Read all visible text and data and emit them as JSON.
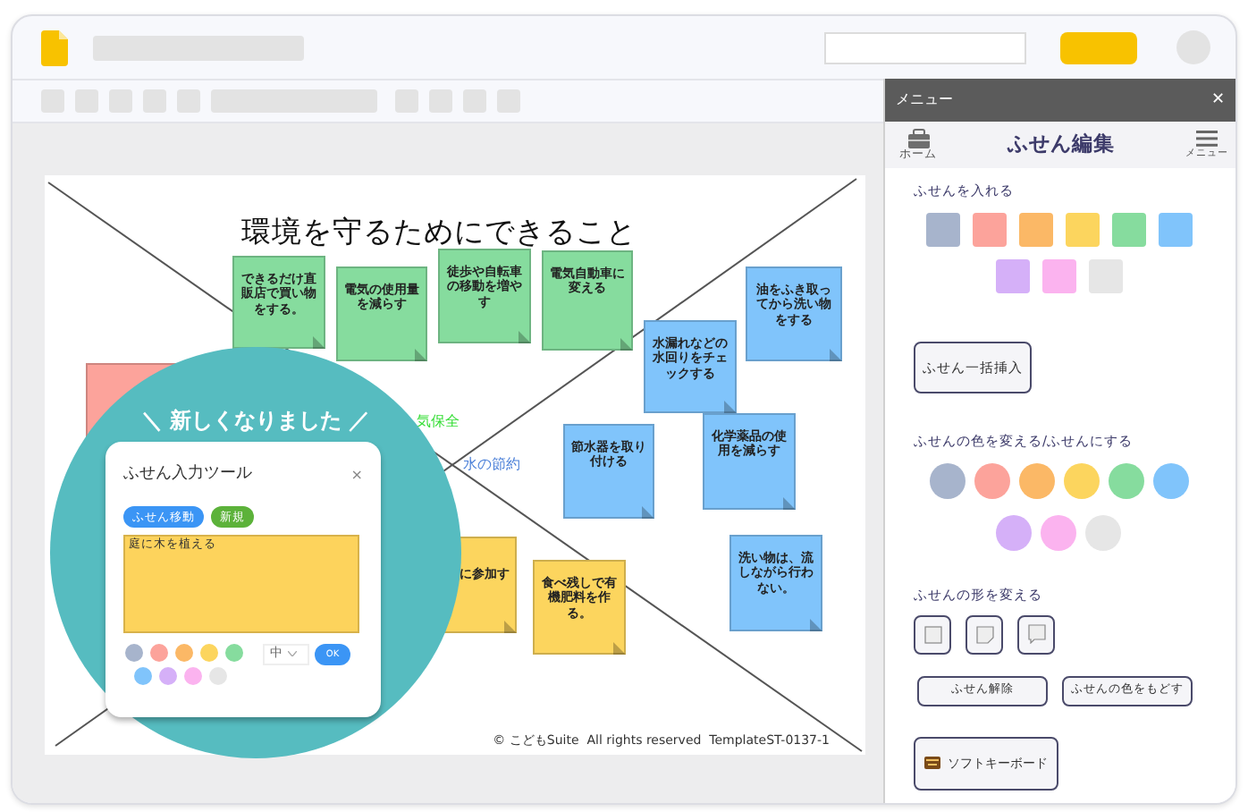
{
  "slide": {
    "title": "環境を守るためにできること",
    "stickies": [
      {
        "text": "できるだけ直販店で買い物をする。",
        "color": "#86dc9e"
      },
      {
        "text": "電気の使用量を減らす",
        "color": "#86dc9e"
      },
      {
        "text": "徒歩や自転車の移動を増やす",
        "color": "#86dc9e"
      },
      {
        "text": "電気自動車に変える",
        "color": "#86dc9e"
      },
      {
        "text": "水漏れなどの水回りをチェックする",
        "color": "#80c4fb"
      },
      {
        "text": "油をふき取ってから洗い物をする",
        "color": "#80c4fb"
      },
      {
        "text": "節水器を取り付ける",
        "color": "#80c4fb"
      },
      {
        "text": "化学薬品の使用を減らす",
        "color": "#80c4fb"
      },
      {
        "text": "洗い物は、流しながら行わない。",
        "color": "#80c4fb"
      },
      {
        "text": "食べ残しで有機肥料を作る。",
        "color": "#fcd55e"
      },
      {
        "text": "に参加す",
        "color": "#fcd55e"
      },
      {
        "color": "#fca39b"
      }
    ],
    "labels": [
      {
        "text": "気保全",
        "color": "#33dd33"
      },
      {
        "text": "水の節約",
        "color": "#4a7fd8"
      }
    ],
    "copyright": "© こどもSuite  All rights reserved  TemplateST-0137-1"
  },
  "promo": {
    "headline": "＼ 新しくなりました ／",
    "dialog": {
      "title": "ふせん入力ツール",
      "close": "×",
      "buttons": [
        {
          "label": "ふせん移動",
          "color": "#3b95f5"
        },
        {
          "label": "新規",
          "color": "#5cb23a"
        }
      ],
      "text_value": "庭に木を植える",
      "colors": [
        {
          "color": "#a7b4cc"
        },
        {
          "color": "#fca39b"
        },
        {
          "color": "#fbb866"
        },
        {
          "color": "#fcd55e"
        },
        {
          "color": "#86dc9e"
        },
        {
          "color": "#80c4fb"
        },
        {
          "color": "#d5b0f8"
        },
        {
          "color": "#fbb3ef"
        },
        {
          "color": "#e6e6e6"
        }
      ],
      "size": "中",
      "ok": "OK"
    }
  },
  "panel": {
    "header": "メニュー",
    "close": "✕",
    "home": "ホーム",
    "title": "ふせん編集",
    "menu": "メニュー",
    "insert_heading": "ふせんを入れる",
    "insert_colors": [
      {
        "color": "#a7b4cc"
      },
      {
        "color": "#fca39b"
      },
      {
        "color": "#fbb866"
      },
      {
        "color": "#fcd55e"
      },
      {
        "color": "#86dc9e"
      },
      {
        "color": "#80c4fb"
      },
      {
        "color": "#d5b0f8"
      },
      {
        "color": "#fbb3ef"
      },
      {
        "color": "#e6e6e6"
      }
    ],
    "bulk_insert": "ふせん一括挿入",
    "recolor_heading": "ふせんの色を変える/ふせんにする",
    "recolor_colors": [
      {
        "color": "#a7b4cc"
      },
      {
        "color": "#fca39b"
      },
      {
        "color": "#fbb866"
      },
      {
        "color": "#fcd55e"
      },
      {
        "color": "#86dc9e"
      },
      {
        "color": "#80c4fb"
      },
      {
        "color": "#d5b0f8"
      },
      {
        "color": "#fbb3ef"
      },
      {
        "color": "#e6e6e6"
      }
    ],
    "shape_heading": "ふせんの形を変える",
    "shapes": [
      {
        "kind": "plain"
      },
      {
        "kind": "folded"
      },
      {
        "kind": "callout"
      }
    ],
    "actions": [
      "ふせん解除",
      "ふせんの色をもどす"
    ],
    "keyboard": "ソフトキーボード"
  }
}
